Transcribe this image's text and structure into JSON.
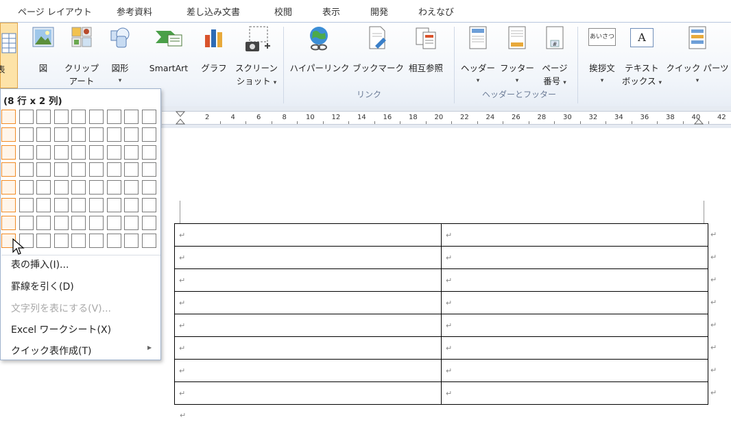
{
  "ribbon_tabs": [
    "ページ レイアウト",
    "参考資料",
    "差し込み文書",
    "校閲",
    "表示",
    "開発",
    "わえなび"
  ],
  "ribbon": {
    "left_partial_label": "表",
    "buttons": {
      "picture": "図",
      "clipart_1": "クリップ",
      "clipart_2": "アート",
      "shapes": "図形",
      "smartart": "SmartArt",
      "chart": "グラフ",
      "screenshot_1": "スクリーン",
      "screenshot_2": "ショット",
      "hyperlink": "ハイパーリンク",
      "bookmark": "ブックマーク",
      "crossref": "相互参照",
      "header": "ヘッダー",
      "footer": "フッター",
      "pagenum_1": "ページ",
      "pagenum_2": "番号",
      "greeting": "挨拶文",
      "textbox_1": "テキスト",
      "textbox_2": "ボックス",
      "quickparts": "クイック パーツ",
      "greeting_icon_text": "あいさつ",
      "textbox_icon_text": "A"
    },
    "groups": {
      "links": "リンク",
      "header_footer": "ヘッダーとフッター"
    },
    "dropdown_glyph": "▾"
  },
  "ruler": {
    "numbers": [
      "2",
      "4",
      "6",
      "8",
      "10",
      "12",
      "14",
      "16",
      "18",
      "20",
      "22",
      "24",
      "26",
      "28",
      "30",
      "32",
      "34",
      "36",
      "38",
      "40",
      "42"
    ]
  },
  "table_menu": {
    "title": "(8 行 x 2 列)",
    "grid": {
      "rows": 8,
      "cols": 9,
      "selected_rows": 8,
      "selected_cols": 1
    },
    "items": [
      {
        "label": "表の挿入(I)...",
        "enabled": true
      },
      {
        "label": "罫線を引く(D)",
        "enabled": true
      },
      {
        "label": "文字列を表にする(V)...",
        "enabled": false
      },
      {
        "label": "Excel ワークシート(X)",
        "enabled": true
      },
      {
        "label": "クイック表作成(T)",
        "enabled": true
      }
    ],
    "submenu_arrow": "▶"
  },
  "document": {
    "table_rows": 8,
    "table_cols": 2,
    "cell_mark": "↵",
    "paragraph_mark": "↵"
  },
  "colors": {
    "selected_cell_border": "#f08a24",
    "menu_border": "#9eb1cc",
    "ribbon_group_label": "#6b7b96"
  }
}
